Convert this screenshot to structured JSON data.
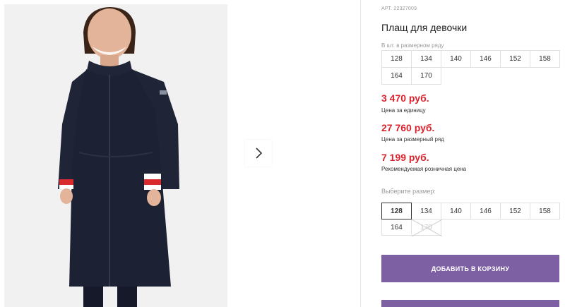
{
  "product": {
    "article_label": "АРТ. 22327009",
    "title": "Плащ для девочки",
    "sizes_in_row_caption": "В шт. в размерном ряду",
    "sizes_in_row": [
      "128",
      "134",
      "140",
      "146",
      "152",
      "158",
      "164",
      "170"
    ],
    "prices": [
      {
        "amount": "3 470 руб.",
        "note": "Цена за единицу"
      },
      {
        "amount": "27 760 руб.",
        "note": "Цена за размерный ряд"
      },
      {
        "amount": "7 199 руб.",
        "note": "Рекомендуемая розничная цена"
      }
    ],
    "choose_size_caption": "Выберите размер:",
    "size_options": [
      {
        "label": "128",
        "state": "selected"
      },
      {
        "label": "134",
        "state": "available"
      },
      {
        "label": "140",
        "state": "available"
      },
      {
        "label": "146",
        "state": "available"
      },
      {
        "label": "152",
        "state": "available"
      },
      {
        "label": "158",
        "state": "available"
      },
      {
        "label": "164",
        "state": "available"
      },
      {
        "label": "170",
        "state": "unavailable"
      }
    ],
    "add_to_cart_label": "ДОБАВИТЬ В КОРЗИНУ"
  },
  "colors": {
    "price": "#d9232e",
    "button": "#7d60a3",
    "coat": "#1c2233"
  },
  "gallery": {
    "next_icon": "chevron-right-icon",
    "image": "girl-in-navy-coat-photo"
  }
}
